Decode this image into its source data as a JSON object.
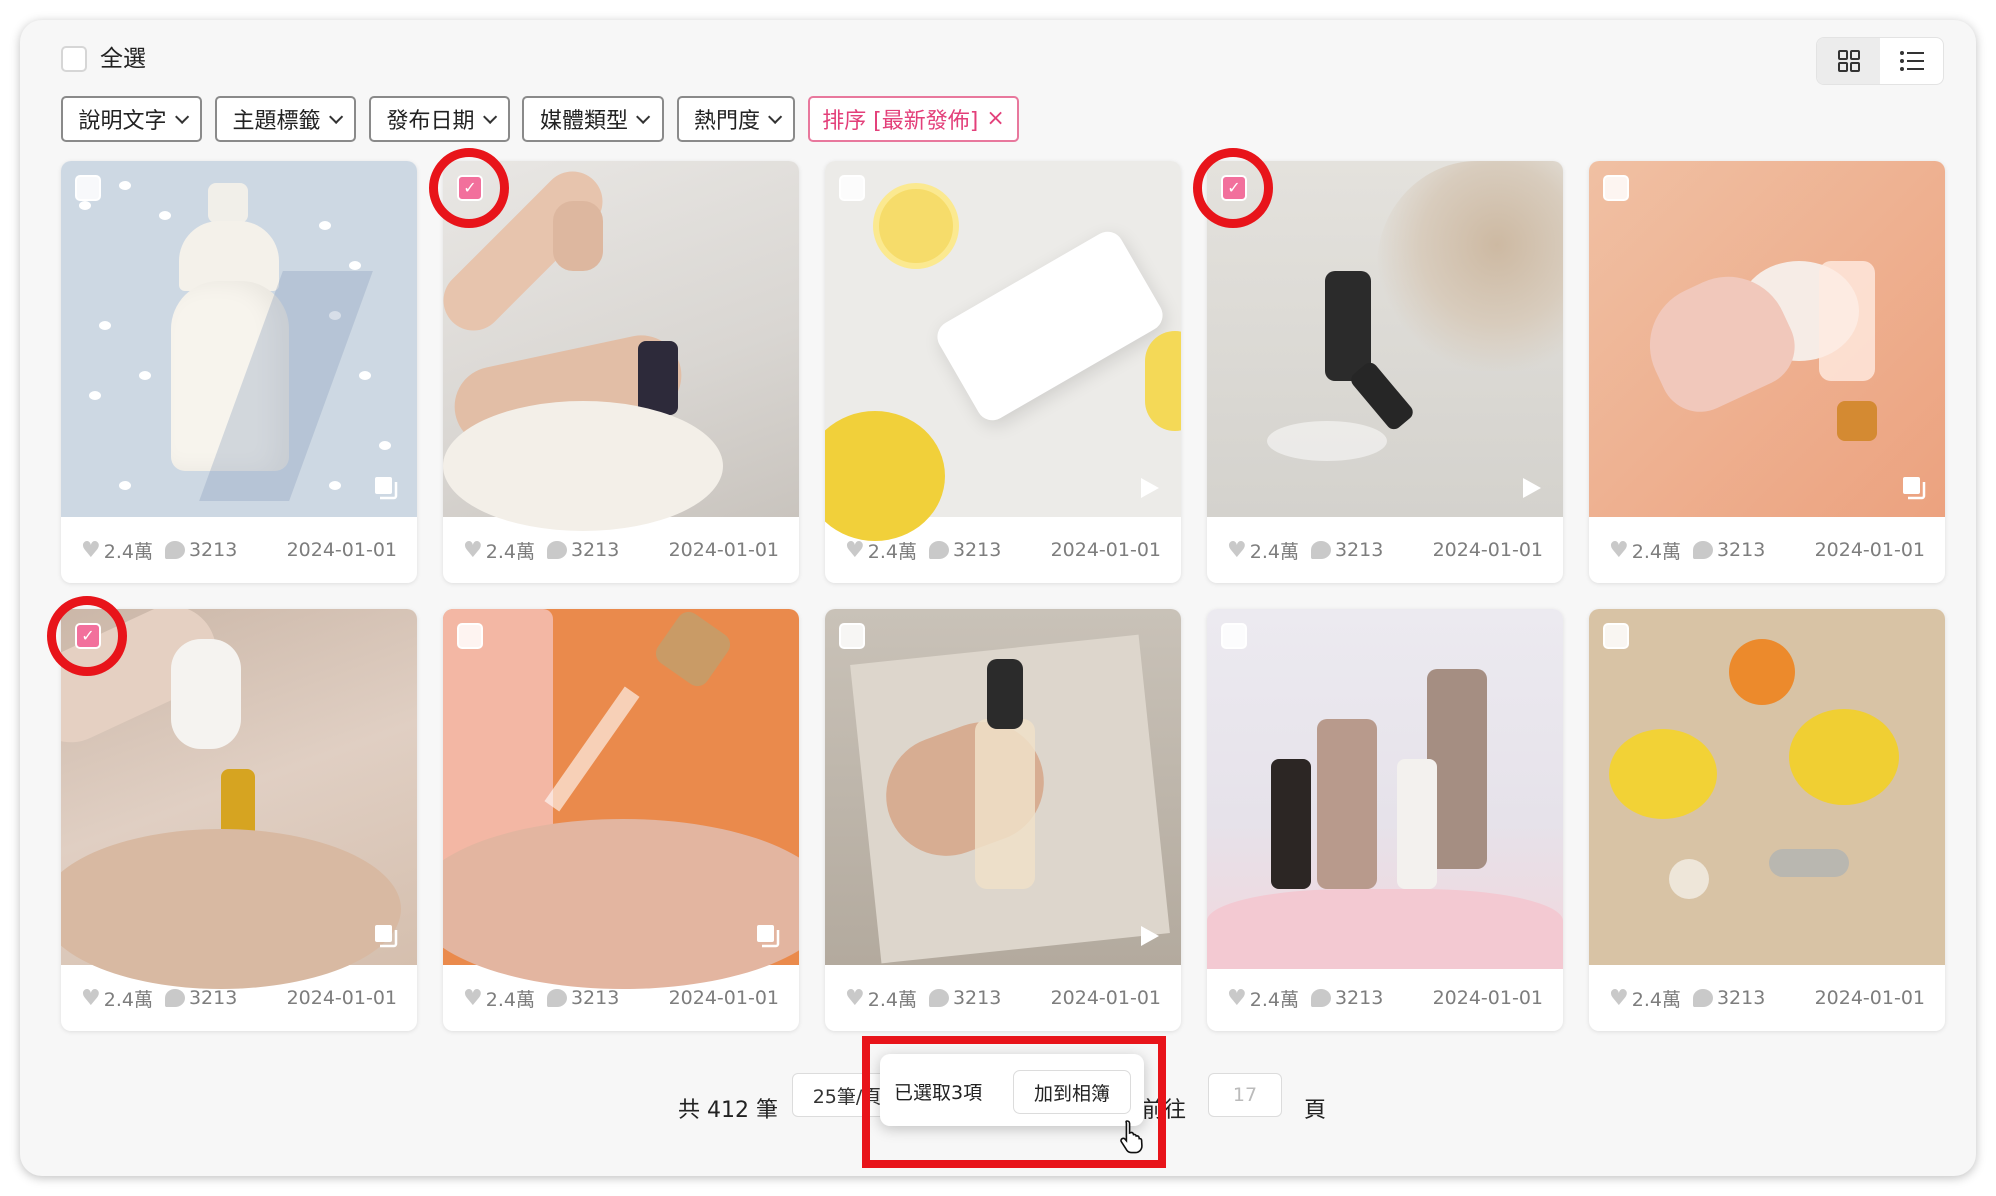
{
  "header": {
    "select_all_label": "全選"
  },
  "view_toggle": {
    "grid_icon": "grid-icon",
    "list_icon": "list-icon",
    "active": "grid"
  },
  "filters": [
    {
      "label": "說明文字"
    },
    {
      "label": "主題標籤"
    },
    {
      "label": "發布日期"
    },
    {
      "label": "媒體類型"
    },
    {
      "label": "熱門度"
    }
  ],
  "sort_chip": {
    "label": "排序 [最新發佈]",
    "close": "×"
  },
  "posts": [
    {
      "likes": "2.4萬",
      "comments": "3213",
      "date": "2024-01-01",
      "selected": false,
      "media": "album"
    },
    {
      "likes": "2.4萬",
      "comments": "3213",
      "date": "2024-01-01",
      "selected": true,
      "media": "none"
    },
    {
      "likes": "2.4萬",
      "comments": "3213",
      "date": "2024-01-01",
      "selected": false,
      "media": "video"
    },
    {
      "likes": "2.4萬",
      "comments": "3213",
      "date": "2024-01-01",
      "selected": true,
      "media": "video"
    },
    {
      "likes": "2.4萬",
      "comments": "3213",
      "date": "2024-01-01",
      "selected": false,
      "media": "album"
    },
    {
      "likes": "2.4萬",
      "comments": "3213",
      "date": "2024-01-01",
      "selected": true,
      "media": "album"
    },
    {
      "likes": "2.4萬",
      "comments": "3213",
      "date": "2024-01-01",
      "selected": false,
      "media": "album"
    },
    {
      "likes": "2.4萬",
      "comments": "3213",
      "date": "2024-01-01",
      "selected": false,
      "media": "video"
    },
    {
      "likes": "2.4萬",
      "comments": "3213",
      "date": "2024-01-01",
      "selected": false,
      "media": "none"
    },
    {
      "likes": "2.4萬",
      "comments": "3213",
      "date": "2024-01-01",
      "selected": false,
      "media": "none"
    }
  ],
  "pagination": {
    "total": "共 412 筆",
    "per_page": "25筆/頁",
    "goto_label": "前往",
    "page_input": "17",
    "page_suffix": "頁"
  },
  "selection_popup": {
    "count_label": "已選取3項",
    "add_button": "加到相簿"
  },
  "colors": {
    "accent": "#f2709c",
    "highlight": "#e8141a"
  }
}
